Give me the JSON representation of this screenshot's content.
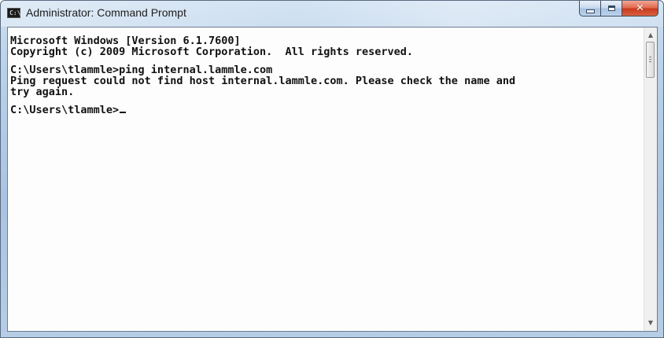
{
  "window": {
    "title": "Administrator: Command Prompt",
    "app_icon_text": "C:\\",
    "caption_buttons": {
      "minimize": "minimize",
      "maximize": "maximize",
      "close": "✕"
    }
  },
  "console": {
    "lines": [
      "Microsoft Windows [Version 6.1.7600]",
      "Copyright (c) 2009 Microsoft Corporation.  All rights reserved.",
      "",
      "C:\\Users\\tlammle>ping internal.lammle.com",
      "Ping request could not find host internal.lammle.com. Please check the name and",
      "try again.",
      "",
      "C:\\Users\\tlammle>"
    ]
  },
  "scrollbar": {
    "up_arrow": "▲",
    "down_arrow": "▼"
  }
}
